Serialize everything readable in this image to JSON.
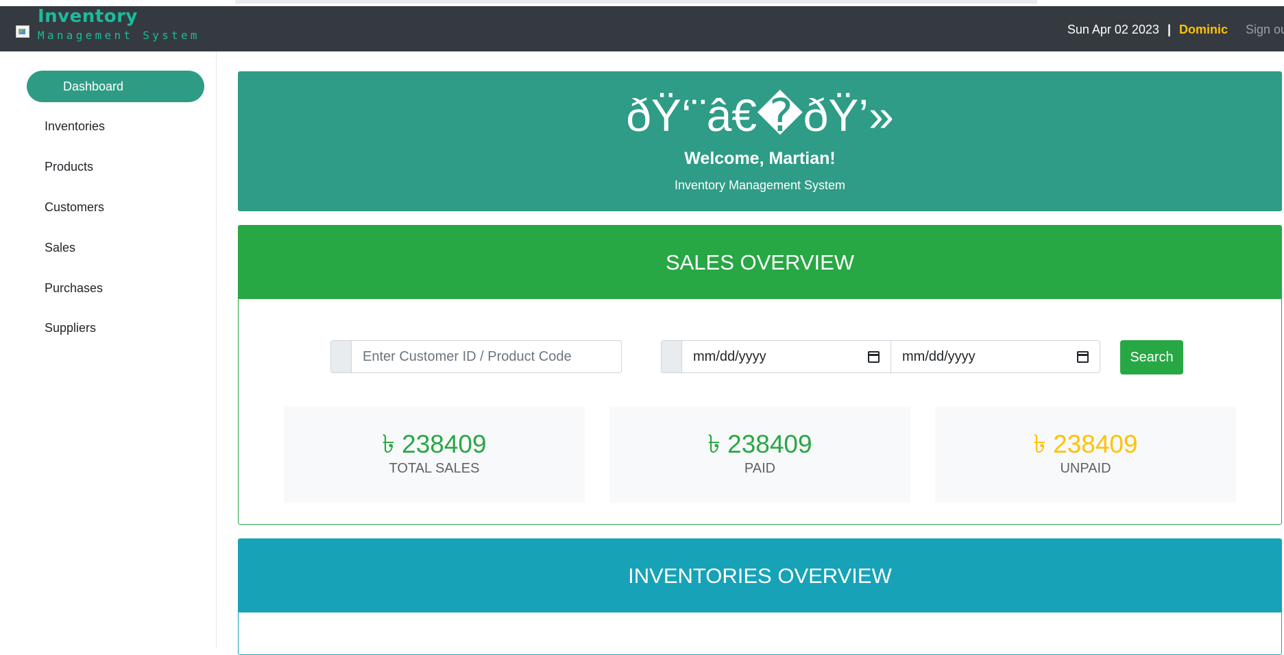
{
  "header": {
    "brand_title": "Inventory",
    "brand_subtitle": "Management System",
    "date": "Sun Apr 02 2023",
    "separator": "|",
    "user": "Dominic",
    "signout": "Sign out"
  },
  "sidebar": {
    "items": [
      {
        "label": "Dashboard"
      },
      {
        "label": "Inventories"
      },
      {
        "label": "Products"
      },
      {
        "label": "Customers"
      },
      {
        "label": "Sales"
      },
      {
        "label": "Purchases"
      },
      {
        "label": "Suppliers"
      }
    ],
    "active": "Dashboard"
  },
  "welcome": {
    "emoji_text": "ðŸ‘¨â€�ðŸ’»",
    "title": "Welcome, Martian!",
    "subtitle": "Inventory Management System"
  },
  "sales": {
    "header": "SALES OVERVIEW",
    "search_placeholder": "Enter Customer ID / Product Code",
    "date_from": "mm/dd/yyyy",
    "date_to": "mm/dd/yyyy",
    "search_button": "Search",
    "stats": [
      {
        "amount": "৳ 238409",
        "label": "TOTAL SALES",
        "color": "#28a745"
      },
      {
        "amount": "৳ 238409",
        "label": "PAID",
        "color": "#28a745"
      },
      {
        "amount": "৳ 238409",
        "label": "UNPAID",
        "color": "#ffc107"
      }
    ]
  },
  "inventories": {
    "header": "INVENTORIES OVERVIEW"
  },
  "colors": {
    "navbar": "#343a40",
    "brand": "#1abc9c",
    "user": "#ffc107",
    "welcome_bg": "#2e9c86",
    "sales_bg": "#28a745",
    "inventories_bg": "#17a2b8"
  }
}
